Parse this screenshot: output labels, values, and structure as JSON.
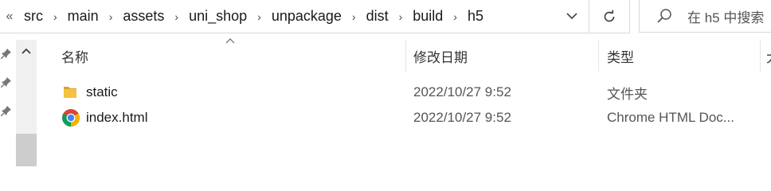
{
  "breadcrumb": {
    "overflow": "«",
    "items": [
      "src",
      "main",
      "assets",
      "uni_shop",
      "unpackage",
      "dist",
      "build",
      "h5"
    ],
    "separator": "›"
  },
  "search": {
    "placeholder": "在 h5 中搜索"
  },
  "columns": {
    "name": "名称",
    "modified": "修改日期",
    "type": "类型",
    "extra": "大"
  },
  "files": [
    {
      "name": "static",
      "modified": "2022/10/27 9:52",
      "type": "文件夹",
      "icon": "folder-icon"
    },
    {
      "name": "index.html",
      "modified": "2022/10/27 9:52",
      "type": "Chrome HTML Doc...",
      "icon": "chrome-icon"
    }
  ],
  "colors": {
    "folder": "#f5c242",
    "chrome_red": "#db4437",
    "chrome_green": "#0f9d58",
    "chrome_yellow": "#f4b400",
    "chrome_blue": "#4285f4"
  }
}
